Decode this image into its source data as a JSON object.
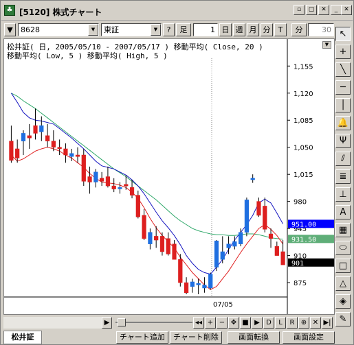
{
  "window": {
    "title": "[5120] 株式チャート",
    "controls": [
      "□",
      "↗",
      "✕"
    ],
    "min_label": "_",
    "max_label": "□",
    "close_label": "✕"
  },
  "toolbar": {
    "dropdown_toggle": "▼",
    "symbol_value": "8628",
    "market_value": "東証",
    "help_label": "?",
    "foot_label": "足",
    "foot_count": "1",
    "period_day": "日",
    "period_week": "週",
    "period_month": "月",
    "period_minute_label": "分",
    "minute_value": "30",
    "tick_u": "分",
    "tick_t": "T"
  },
  "chart": {
    "info_line1": "松井証( 日, 2005/05/10 - 2007/05/17 )  移動平均( Close, 20 )",
    "info_line2": "移動平均( Low, 5 )  移動平均( High, 5 )",
    "xaxis_label": "07/05",
    "price_labels": [
      {
        "label": "1,155",
        "value": 1155
      },
      {
        "label": "1,120",
        "value": 1120
      },
      {
        "label": "1,085",
        "value": 1085
      },
      {
        "label": "1,050",
        "value": 1050
      },
      {
        "label": "1,015",
        "value": 1015
      },
      {
        "label": "980",
        "value": 980
      },
      {
        "label": "945",
        "value": 945
      },
      {
        "label": "910",
        "value": 910
      },
      {
        "label": "875",
        "value": 875
      }
    ],
    "markers": [
      {
        "label": "951.00",
        "value": 951,
        "color": "#0000ff"
      },
      {
        "label": "931.50",
        "value": 931.5,
        "color": "#5fae78"
      },
      {
        "label": "901",
        "value": 901,
        "color": "#000000"
      }
    ],
    "colors": {
      "up": "#1f6fe0",
      "down": "#dd1f1f",
      "ma_close": "#2fa86a",
      "ma_low": "#e02020",
      "ma_high": "#1515c0"
    }
  },
  "chart_data": {
    "type": "line",
    "title": "松井証( 日, 2005/05/10 - 2007/05/17 )",
    "ylim": [
      860,
      1165
    ],
    "xlabel": "07/05",
    "series": [
      {
        "name": "Candles",
        "kind": "ohlc",
        "data": [
          [
            1058,
            1078,
            1030,
            1033
          ],
          [
            1048,
            1060,
            1030,
            1036
          ],
          [
            1058,
            1072,
            1040,
            1068
          ],
          [
            1065,
            1080,
            1048,
            1062
          ],
          [
            1078,
            1100,
            1060,
            1068
          ],
          [
            1070,
            1090,
            1058,
            1078
          ],
          [
            1065,
            1080,
            1050,
            1058
          ],
          [
            1058,
            1072,
            1045,
            1050
          ],
          [
            1050,
            1060,
            1040,
            1048
          ],
          [
            1048,
            1055,
            1030,
            1040
          ],
          [
            1038,
            1048,
            1032,
            1042
          ],
          [
            1040,
            1050,
            1030,
            1038
          ],
          [
            1040,
            1048,
            1000,
            1006
          ],
          [
            1012,
            1025,
            990,
            1005
          ],
          [
            1005,
            1022,
            998,
            1018
          ],
          [
            1010,
            1018,
            1000,
            1006
          ],
          [
            1012,
            1025,
            998,
            1000
          ],
          [
            1000,
            1010,
            992,
            996
          ],
          [
            998,
            1005,
            990,
            998
          ],
          [
            1002,
            1014,
            995,
            1000
          ],
          [
            998,
            1008,
            984,
            988
          ],
          [
            988,
            994,
            958,
            960
          ],
          [
            962,
            970,
            930,
            932
          ],
          [
            925,
            945,
            918,
            940
          ],
          [
            935,
            948,
            920,
            930
          ],
          [
            935,
            940,
            910,
            915
          ],
          [
            932,
            940,
            910,
            912
          ],
          [
            925,
            930,
            905,
            905
          ],
          [
            905,
            912,
            870,
            875
          ],
          [
            875,
            882,
            860,
            862
          ],
          [
            870,
            880,
            862,
            876
          ],
          [
            872,
            880,
            860,
            874
          ],
          [
            868,
            882,
            862,
            872
          ],
          [
            868,
            888,
            866,
            886
          ],
          [
            895,
            930,
            890,
            929
          ],
          [
            905,
            935,
            900,
            915
          ],
          [
            920,
            935,
            912,
            925
          ],
          [
            922,
            935,
            918,
            928
          ],
          [
            925,
            945,
            922,
            940
          ],
          [
            940,
            985,
            935,
            982
          ],
          [
            1008,
            1015,
            1004,
            1010
          ],
          [
            980,
            985,
            960,
            962
          ],
          [
            974,
            985,
            940,
            944
          ],
          [
            938,
            945,
            920,
            932
          ],
          [
            922,
            928,
            910,
            910
          ],
          [
            915,
            930,
            898,
            898
          ]
        ]
      },
      {
        "name": "移動平均( Close, 20 )",
        "values": [
          1120,
          1116,
          1110,
          1105,
          1100,
          1094,
          1088,
          1082,
          1076,
          1070,
          1064,
          1058,
          1052,
          1046,
          1040,
          1034,
          1028,
          1022,
          1017,
          1012,
          1006,
          1000,
          994,
          988,
          982,
          975,
          968,
          961,
          955,
          950,
          945,
          942,
          940,
          938,
          937,
          937,
          936,
          936,
          937,
          938,
          938,
          937,
          935,
          933,
          932,
          931
        ]
      },
      {
        "name": "移動平均( Low, 5 )",
        "values": [
          1040,
          1032,
          1035,
          1040,
          1045,
          1048,
          1050,
          1048,
          1045,
          1040,
          1036,
          1030,
          1024,
          1016,
          1010,
          1005,
          1004,
          1003,
          1001,
          998,
          992,
          984,
          972,
          958,
          946,
          936,
          928,
          920,
          908,
          898,
          888,
          880,
          872,
          866,
          870,
          880,
          890,
          902,
          914,
          925,
          935,
          945,
          950,
          944,
          936,
          925
        ]
      },
      {
        "name": "移動平均( High, 5 )",
        "values": [
          1120,
          1108,
          1095,
          1088,
          1085,
          1084,
          1082,
          1080,
          1074,
          1068,
          1062,
          1055,
          1048,
          1040,
          1032,
          1026,
          1024,
          1022,
          1018,
          1014,
          1008,
          1000,
          990,
          978,
          966,
          955,
          946,
          936,
          924,
          910,
          900,
          892,
          888,
          886,
          895,
          905,
          918,
          930,
          940,
          950,
          962,
          978,
          983,
          978,
          965,
          951
        ]
      }
    ]
  },
  "palette": {
    "items": [
      "↖",
      "+",
      "╲",
      "─",
      "│",
      "🔔",
      "Ψ",
      "⫽",
      "≣",
      "⊥",
      "A",
      "▦",
      "⬭",
      "□",
      "△",
      "◈",
      "✎"
    ]
  },
  "scrollbar": {
    "left_arrow": "◀",
    "right_arrow": "▶",
    "nav_buttons": [
      "◂◂",
      "+",
      "−",
      "✥",
      "■",
      "▶",
      "D",
      "L",
      "R",
      "⊕",
      "✕",
      "▶|"
    ]
  },
  "tabs": {
    "main": "松井証",
    "add_chart": "チャート追加",
    "delete_chart": "チャート削除",
    "switch_screen": "画面転換",
    "screen_settings": "画面設定"
  }
}
